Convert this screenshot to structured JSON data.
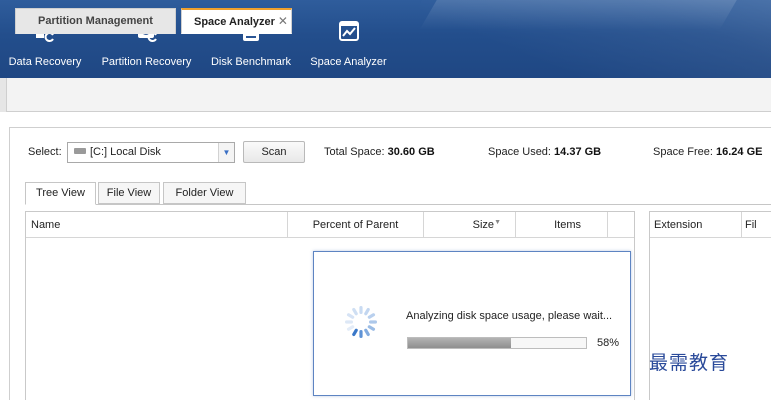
{
  "toolbar": {
    "items": [
      {
        "label": "Data Recovery",
        "icon": "data-recovery-icon"
      },
      {
        "label": "Partition Recovery",
        "icon": "partition-recovery-icon"
      },
      {
        "label": "Disk Benchmark",
        "icon": "disk-benchmark-icon"
      },
      {
        "label": "Space Analyzer",
        "icon": "space-analyzer-icon"
      }
    ]
  },
  "doc_tabs": {
    "partition_management": "Partition Management",
    "space_analyzer": "Space Analyzer",
    "close_glyph": "✕"
  },
  "analyzer": {
    "select_label": "Select:",
    "drive_value": "[C:] Local Disk",
    "scan_label": "Scan",
    "total_label": "Total Space:",
    "total_value": "30.60 GB",
    "used_label": "Space Used:",
    "used_value": "14.37 GB",
    "free_label": "Space Free:",
    "free_value": "16.24 GE"
  },
  "view_tabs": [
    "Tree View",
    "File View",
    "Folder View"
  ],
  "columns": {
    "name": "Name",
    "percent": "Percent of Parent",
    "size": "Size",
    "items": "Items",
    "extension": "Extension",
    "file_cut": "Fil"
  },
  "progress": {
    "message": "Analyzing disk space usage, please wait...",
    "percent_text": "58%",
    "percent": 58
  },
  "watermark": "最需教育",
  "colors": {
    "ribbon": "#234e8c",
    "active_tab_accent": "#f0a02c",
    "spinner": "#3a78c8",
    "dialog_border": "#5d84c2"
  }
}
